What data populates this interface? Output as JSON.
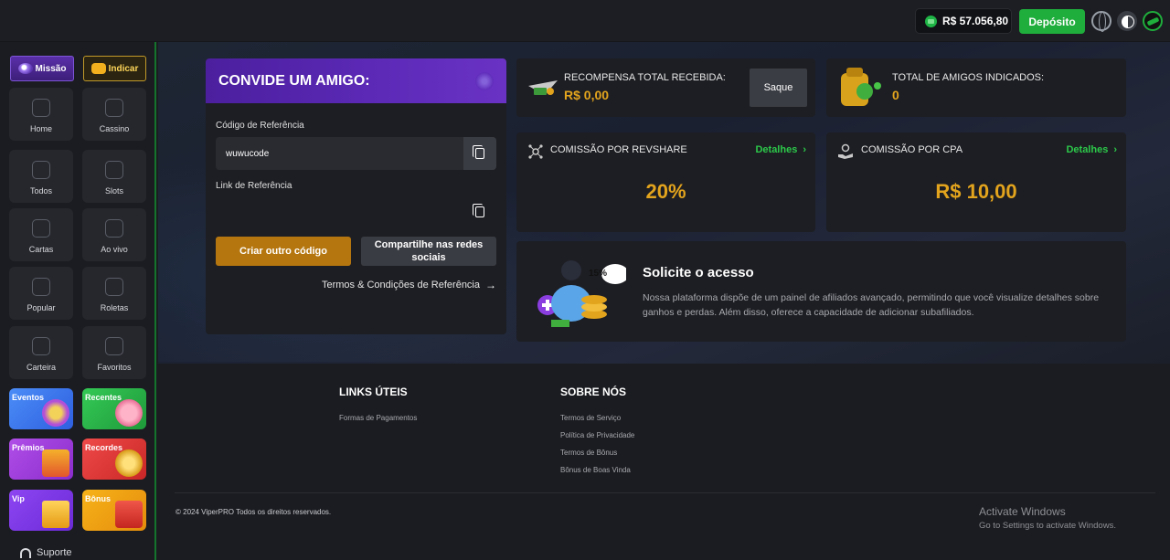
{
  "topbar": {
    "balance": "R$ 57.056,80",
    "deposit_label": "Depósito",
    "icons": [
      "coin-icon",
      "globe-icon",
      "theme-toggle-icon",
      "avatar-icon"
    ]
  },
  "sidebar": {
    "mission_label": "Missão",
    "indicar_label": "Indicar",
    "nav": [
      {
        "label": "Home",
        "icon": "home-icon"
      },
      {
        "label": "Cassino",
        "icon": "casino-icon"
      },
      {
        "label": "Todos",
        "icon": "rocket-icon"
      },
      {
        "label": "Slots",
        "icon": "slot-machine-icon"
      },
      {
        "label": "Cartas",
        "icon": "cards-icon"
      },
      {
        "label": "Ao vivo",
        "icon": "live-dealer-icon"
      },
      {
        "label": "Popular",
        "icon": "flame-icon"
      },
      {
        "label": "Roletas",
        "icon": "roulette-icon"
      },
      {
        "label": "Carteira",
        "icon": "wallet-icon"
      },
      {
        "label": "Favoritos",
        "icon": "folder-icon"
      }
    ],
    "promos": [
      {
        "label": "Eventos",
        "color": "#3b7bf3"
      },
      {
        "label": "Recentes",
        "color": "#27b14a"
      },
      {
        "label": "Prêmios",
        "color": "#a43ce0"
      },
      {
        "label": "Recordes",
        "color": "#e23a3a"
      },
      {
        "label": "Vip",
        "color": "#7b34e6"
      },
      {
        "label": "Bônus",
        "color": "#f0a312"
      }
    ],
    "support_label": "Suporte"
  },
  "invite": {
    "title": "CONVIDE UM AMIGO:",
    "code_label": "Código de Referência",
    "code_value": "wuwucode",
    "link_label": "Link de Referência",
    "link_value": "",
    "create_label": "Criar outro código",
    "share_label": "Compartilhe nas redes sociais",
    "terms_label": "Termos & Condições de Referência"
  },
  "stats": {
    "reward_title": "RECOMPENSA TOTAL RECEBIDA:",
    "reward_value": "R$ 0,00",
    "saque_label": "Saque",
    "friends_title": "TOTAL DE AMIGOS INDICADOS:",
    "friends_value": "0",
    "revshare_title": "COMISSÃO POR REVSHARE",
    "revshare_value": "20%",
    "cpa_title": "COMISSÃO POR CPA",
    "cpa_value": "R$ 10,00",
    "details_label": "Detalhes"
  },
  "access": {
    "badge": "15%",
    "title": "Solicite o acesso",
    "description": "Nossa plataforma dispõe de um painel de afiliados avançado, permitindo que você visualize detalhes sobre ganhos e perdas. Além disso, oferece a capacidade de adicionar subafiliados."
  },
  "footer": {
    "useful_title": "LINKS ÚTEIS",
    "useful_links": [
      "Formas de Pagamentos"
    ],
    "about_title": "SOBRE NÓS",
    "about_links": [
      "Termos de Serviço",
      "Política de Privacidade",
      "Termos de Bônus",
      "Bônus de Boas Vinda"
    ],
    "copyright": "© 2024 ViperPRO Todos os direitos reservados."
  },
  "watermark": {
    "line1": "Activate Windows",
    "line2": "Go to Settings to activate Windows."
  },
  "colors": {
    "accent_green": "#1fad3c",
    "accent_gold": "#e3a41d",
    "invite_purple": "#5d2ab8"
  }
}
